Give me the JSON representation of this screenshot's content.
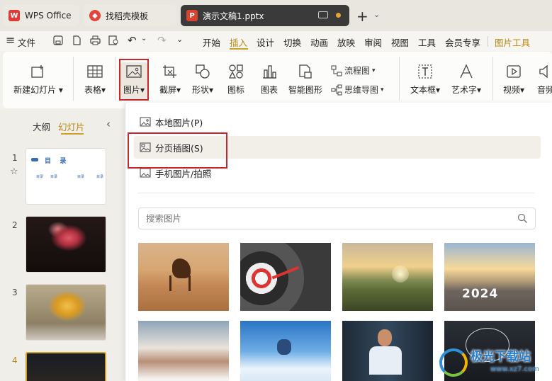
{
  "tabs": [
    {
      "label": "WPS Office",
      "logo": "W"
    },
    {
      "label": "找稻壳模板",
      "logo": "稻"
    },
    {
      "label": "演示文稿1.pptx",
      "logo": "P"
    }
  ],
  "menu": {
    "file": "文件",
    "items": [
      "开始",
      "插入",
      "设计",
      "切换",
      "动画",
      "放映",
      "审阅",
      "视图",
      "工具",
      "会员专享"
    ],
    "active": "插入",
    "picture_tools": "图片工具"
  },
  "ribbon": {
    "new_slide": "新建幻灯片",
    "table": "表格",
    "picture": "图片",
    "screenshot": "截屏",
    "shape": "形状",
    "icon": "图标",
    "chart": "图表",
    "smartart": "智能图形",
    "flowchart": "流程图",
    "mindmap": "思维导图",
    "textbox": "文本框",
    "wordart": "艺术字",
    "video": "视频",
    "audio": "音频"
  },
  "leftpanel": {
    "tab_outline": "大纲",
    "tab_slides": "幻灯片",
    "slide_numbers": [
      "1",
      "2",
      "3",
      "4"
    ],
    "slide1": {
      "title": "目    录",
      "items": [
        "目录",
        "目录",
        "目录",
        "目录"
      ]
    }
  },
  "dropdown": {
    "local_picture": "本地图片(P)",
    "paged_insert": "分页插图(S)",
    "phone_picture": "手机图片/拍照",
    "search_placeholder": "搜索图片",
    "year_text": "2024"
  },
  "watermark": {
    "name": "极光下载站",
    "url": "www.xz7.com"
  },
  "colors": {
    "accent": "#c9a227",
    "highlight": "#c9252c",
    "doc_tab": "#3a3a3a"
  }
}
